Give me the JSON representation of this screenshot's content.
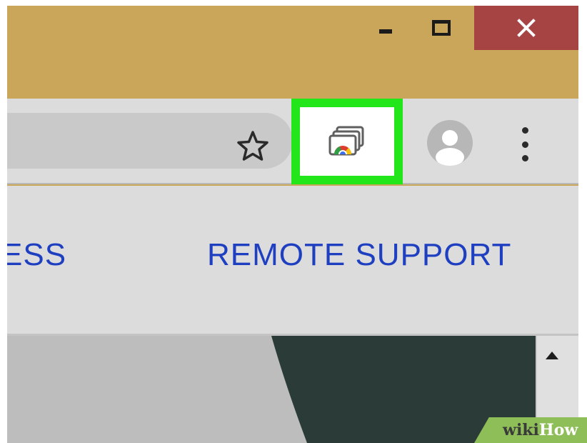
{
  "window": {
    "controls": {
      "minimize": "minimize-icon",
      "maximize": "maximize-icon",
      "close": "close-icon"
    },
    "close_color": "#a64444",
    "frame_color": "#c9a65a"
  },
  "toolbar": {
    "bookmark_icon": "star-icon",
    "extension_icon": "chrome-remote-desktop-icon",
    "highlight_color": "#22e61a",
    "profile_icon": "avatar-icon",
    "menu_icon": "kebab-menu-icon"
  },
  "tabs": [
    {
      "label": "ESS"
    },
    {
      "label": "REMOTE SUPPORT"
    }
  ],
  "tab_color": "#1f3fc1",
  "scroll": {
    "icon": "scroll-up-arrow-icon"
  },
  "watermark": {
    "part1": "wiki",
    "part2": "How"
  }
}
